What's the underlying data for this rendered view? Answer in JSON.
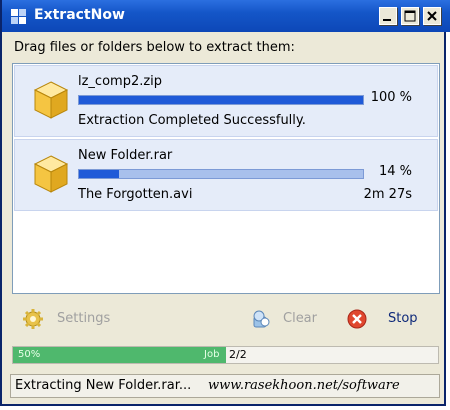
{
  "window": {
    "title": "ExtractNow"
  },
  "instruction": "Drag files or folders below to extract them:",
  "jobs": [
    {
      "file": "lz_comp2.zip",
      "progress_percent": 100,
      "percent_label": "100 %",
      "status": "Extraction Completed Successfully.",
      "eta": ""
    },
    {
      "file": "New Folder.rar",
      "progress_percent": 14,
      "percent_label": "14 %",
      "status": "The Forgotten.avi",
      "eta": "2m 27s"
    }
  ],
  "toolbar": {
    "settings": "Settings",
    "clear": "Clear",
    "stop": "Stop"
  },
  "overall": {
    "percent": 50,
    "percent_label": "50%",
    "job_label": "Job",
    "count": "2/2"
  },
  "statusbar": {
    "text": "Extracting New Folder.rar..."
  },
  "watermark": "www.rasekhoon.net/software",
  "colors": {
    "accent": "#1f5ad8",
    "overall_fill": "#4fb86d",
    "item_bg": "#e5ecf9"
  },
  "icons": [
    "app-icon",
    "package-box-icon",
    "gear-icon",
    "clear-icon",
    "stop-icon"
  ]
}
